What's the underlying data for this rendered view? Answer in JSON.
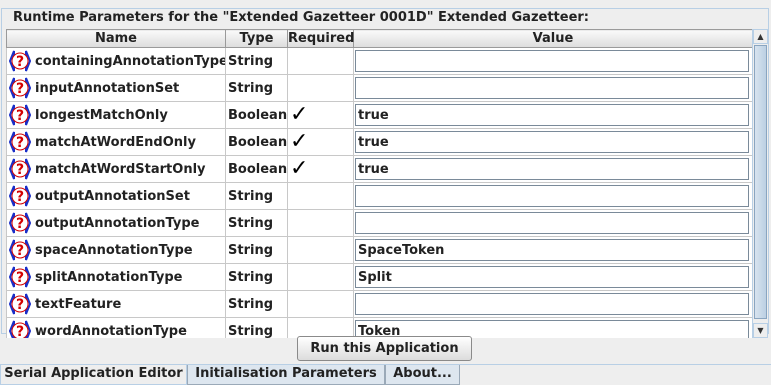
{
  "group_title": "Runtime Parameters for the \"Extended Gazetteer 0001D\" Extended Gazetteer:",
  "columns": [
    "Name",
    "Type",
    "Required",
    "Value"
  ],
  "rows": [
    {
      "name": "containingAnnotationType",
      "type": "String",
      "required": "",
      "value": ""
    },
    {
      "name": "inputAnnotationSet",
      "type": "String",
      "required": "",
      "value": ""
    },
    {
      "name": "longestMatchOnly",
      "type": "Boolean",
      "required": "✓",
      "value": "true"
    },
    {
      "name": "matchAtWordEndOnly",
      "type": "Boolean",
      "required": "✓",
      "value": "true"
    },
    {
      "name": "matchAtWordStartOnly",
      "type": "Boolean",
      "required": "✓",
      "value": "true"
    },
    {
      "name": "outputAnnotationSet",
      "type": "String",
      "required": "",
      "value": ""
    },
    {
      "name": "outputAnnotationType",
      "type": "String",
      "required": "",
      "value": ""
    },
    {
      "name": "spaceAnnotationType",
      "type": "String",
      "required": "",
      "value": "SpaceToken"
    },
    {
      "name": "splitAnnotationType",
      "type": "String",
      "required": "",
      "value": "Split"
    },
    {
      "name": "textFeature",
      "type": "String",
      "required": "",
      "value": ""
    },
    {
      "name": "wordAnnotationType",
      "type": "String",
      "required": "",
      "value": "Token"
    }
  ],
  "run_button": "Run this Application",
  "tabs": [
    "Serial Application Editor",
    "Initialisation Parameters",
    "About..."
  ],
  "icons": {
    "param": "help-question-icon",
    "scroll_up": "arrow-up-icon",
    "scroll_down": "arrow-down-icon"
  },
  "colors": {
    "accent": "#b8cfe5",
    "icon_red": "#d40000",
    "icon_blue": "#1a2fc8"
  }
}
